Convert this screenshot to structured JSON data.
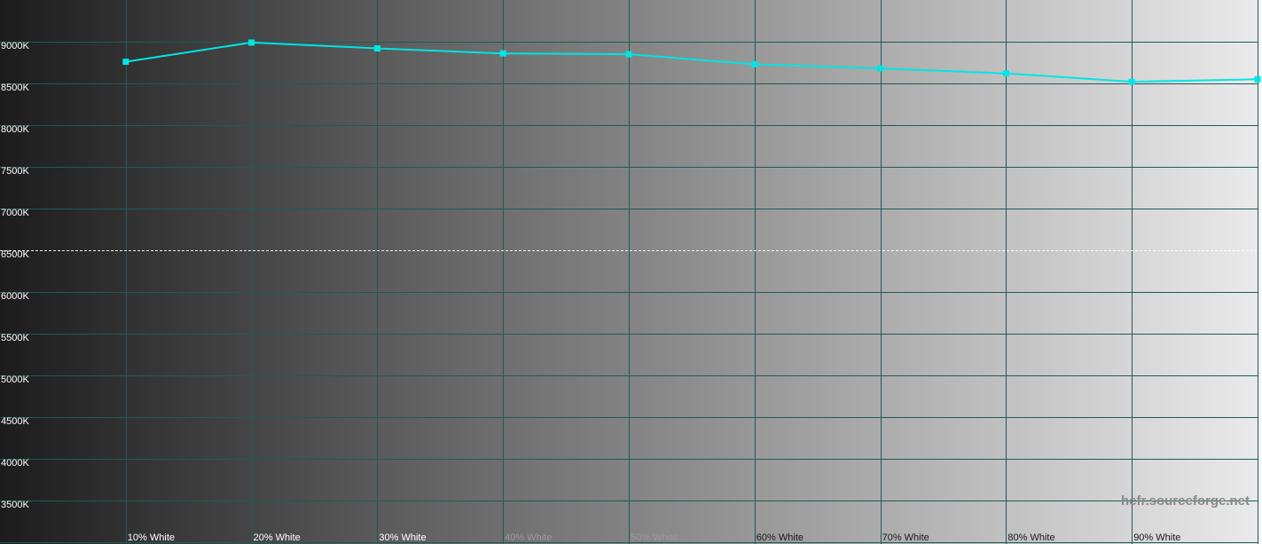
{
  "chart_data": {
    "type": "line",
    "categories": [
      "",
      "10% White",
      "20% White",
      "30% White",
      "40% White",
      "50% White",
      "60% White",
      "70% White",
      "80% White",
      "90% White",
      ""
    ],
    "y_ticks": [
      "3500K",
      "4000K",
      "4500K",
      "5000K",
      "5500K",
      "6000K",
      "6500K",
      "7000K",
      "7500K",
      "8000K",
      "8500K",
      "9000K"
    ],
    "ylim": [
      3000,
      9000
    ],
    "reference_value": 6500,
    "grid": true,
    "series": [
      {
        "values": [
          null,
          8760,
          8990,
          8920,
          8860,
          8850,
          8730,
          8680,
          8620,
          8520,
          8550
        ],
        "color": "#00e5e5"
      }
    ],
    "background_gradient": [
      "#1c1c1c",
      "#ffffff"
    ],
    "grid_color": "#1f5a5a"
  },
  "watermark": "hcfr.sourceforge.net"
}
